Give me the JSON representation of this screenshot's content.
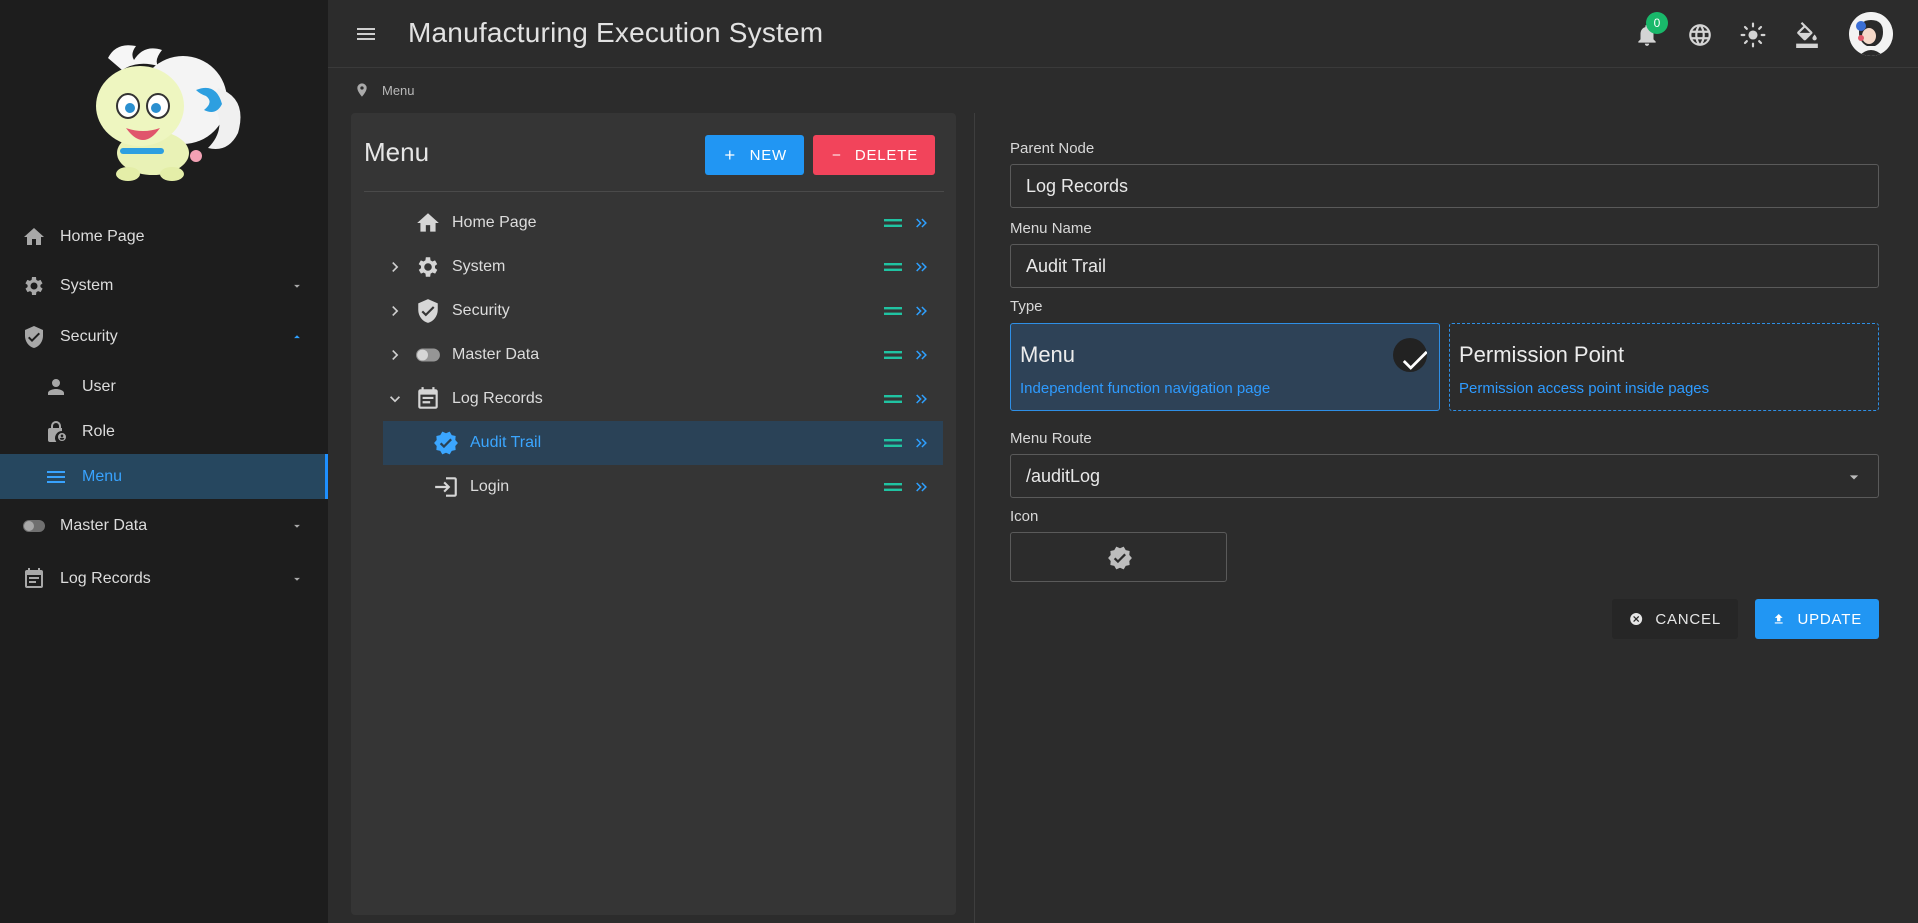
{
  "app": {
    "title": "Manufacturing Execution System",
    "notification_count": "0"
  },
  "sidebar": {
    "items": [
      {
        "label": "Home Page",
        "icon": "home-icon"
      },
      {
        "label": "System",
        "icon": "gear-icon"
      },
      {
        "label": "Security",
        "icon": "shield-icon"
      },
      {
        "label": "User",
        "icon": "person-icon"
      },
      {
        "label": "Role",
        "icon": "lock-person-icon"
      },
      {
        "label": "Menu",
        "icon": "menu-list-icon"
      },
      {
        "label": "Master Data",
        "icon": "toggle-icon"
      },
      {
        "label": "Log Records",
        "icon": "calendar-icon"
      }
    ]
  },
  "breadcrumb": {
    "label": "Menu"
  },
  "tree_panel": {
    "title": "Menu",
    "new_label": "NEW",
    "delete_label": "DELETE",
    "rows": [
      {
        "label": "Home Page",
        "icon": "home-icon"
      },
      {
        "label": "System",
        "icon": "gear-icon"
      },
      {
        "label": "Security",
        "icon": "shield-icon"
      },
      {
        "label": "Master Data",
        "icon": "toggle-icon"
      },
      {
        "label": "Log Records",
        "icon": "calendar-icon"
      },
      {
        "label": "Audit Trail",
        "icon": "verified-icon"
      },
      {
        "label": "Login",
        "icon": "login-icon"
      }
    ]
  },
  "form": {
    "parent_label": "Parent Node",
    "parent_value": "Log Records",
    "name_label": "Menu Name",
    "name_value": "Audit Trail",
    "type_label": "Type",
    "type_menu_title": "Menu",
    "type_menu_desc": "Independent function navigation page",
    "type_perm_title": "Permission Point",
    "type_perm_desc": "Permission access point inside pages",
    "route_label": "Menu Route",
    "route_value": "/auditLog",
    "icon_label": "Icon",
    "icon_value": "verified-icon",
    "cancel_label": "CANCEL",
    "update_label": "UPDATE"
  },
  "colors": {
    "accent": "#2196f3",
    "danger": "#f2445b",
    "drag_handle": "#20c3a2",
    "badge": "#19b86a"
  }
}
